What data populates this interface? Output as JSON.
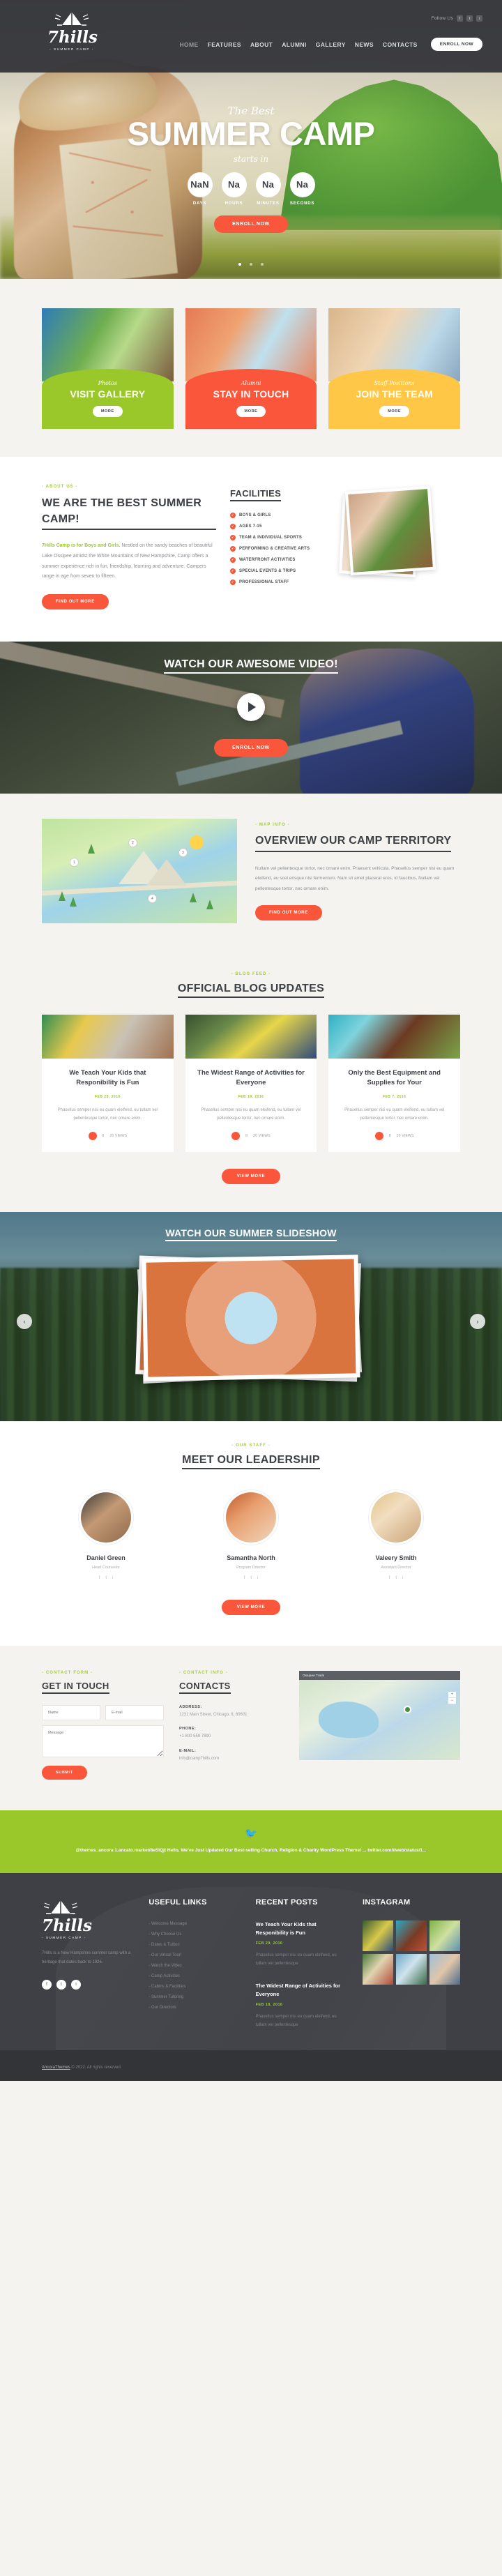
{
  "header": {
    "logo_name": "7hills",
    "logo_sub": "- SUMMER CAMP -",
    "follow_label": "Follow Us",
    "socials": [
      "f",
      "t",
      "i"
    ],
    "nav": [
      {
        "label": "HOME"
      },
      {
        "label": "FEATURES"
      },
      {
        "label": "ABOUT"
      },
      {
        "label": "ALUMNI"
      },
      {
        "label": "GALLERY"
      },
      {
        "label": "NEWS"
      },
      {
        "label": "CONTACTS"
      }
    ],
    "enroll_label": "ENROLL NOW"
  },
  "hero": {
    "pre_title": "The Best",
    "title": "SUMMER CAMP",
    "starts_in": "starts in",
    "countdown": [
      {
        "value": "NaN",
        "label": "DAYS"
      },
      {
        "value": "Na",
        "label": "HOURS"
      },
      {
        "value": "Na",
        "label": "MINUTES"
      },
      {
        "value": "Na",
        "label": "SECONDS"
      }
    ],
    "cta": "ENROLL NOW",
    "slides": 3,
    "active_slide": 1
  },
  "promo": [
    {
      "kicker": "Photos",
      "title": "VISIT GALLERY",
      "more": "MORE"
    },
    {
      "kicker": "Alumni",
      "title": "STAY IN TOUCH",
      "more": "MORE"
    },
    {
      "kicker": "Staff Positions",
      "title": "JOIN THE TEAM",
      "more": "MORE"
    }
  ],
  "about": {
    "label": "- ABOUT US -",
    "title": "WE ARE THE BEST SUMMER CAMP!",
    "lead": "7Hills Camp is for Boys and Girls.",
    "body": " Nestled on the sandy beaches of beautiful Lake Ossipee amidst the White Mountains of New Hampshire, Camp offers a summer experience rich in fun, friendship, learning and adventure. Campers range in age from seven to fifteen.",
    "cta": "FIND OUT MORE",
    "facilities_title": "FACILITIES",
    "facilities": [
      "BOYS & GIRLS",
      "AGES 7-15",
      "TEAM & INDIVIDUAL SPORTS",
      "PERFORMING & CREATIVE ARTS",
      "WATERFRONT ACTIVITIES",
      "SPECIAL EVENTS & TRIPS",
      "PROFESSIONAL STAFF"
    ]
  },
  "video": {
    "title": "WATCH OUR AWESOME VIDEO!",
    "play_icon": "play-icon",
    "cta": "ENROLL NOW"
  },
  "territory": {
    "label": "- MAP INFO -",
    "title": "OVERVIEW OUR CAMP TERRITORY",
    "body": "Nullam vel pellentesque tortor, nec ornare enim. Praesent vehicula. Phasellus semper nisi eu quam eleifend, eu scel erisque nisi fermentum. Nam sit amet placerat eros, id faucibus. Nullam vel pellentesque tortor, nec ornare enim.",
    "cta": "FIND OUT MORE",
    "pins": [
      "1",
      "2",
      "3",
      "4"
    ]
  },
  "blog": {
    "label": "- BLOG FEED -",
    "title": "OFFICIAL BLOG UPDATES",
    "view_more": "VIEW MORE",
    "posts": [
      {
        "title": "We Teach Your Kids that Responibility is Fun",
        "date": "FEB 29, 2016",
        "excerpt": "Phasellus semper nisi eu quam eleifend, eu tullam vel pellentesque tortor, nec ornare enim.",
        "likes": "8",
        "comments": "20 VIEWS"
      },
      {
        "title": "The Widest Range of Activities for Everyone",
        "date": "FEB 18, 2016",
        "excerpt": "Phasellus semper nisi eu quam eleifend, eu tullam vel pellentesque tortor, nec ornare enim.",
        "likes": "8",
        "comments": "20 VIEWS"
      },
      {
        "title": "Only the Best Equipment and Supplies for Your",
        "date": "FEB 7, 2016",
        "excerpt": "Phasellus semper nisi eu quam eleifend, eu tullam vel pellentesque tortor, nec ornare enim.",
        "likes": "8",
        "comments": "20 VIEWS"
      }
    ]
  },
  "slideshow": {
    "title": "WATCH OUR SUMMER SLIDESHOW",
    "prev": "‹",
    "next": "›"
  },
  "leadership": {
    "label": "- OUR STAFF -",
    "title": "MEET OUR LEADERSHIP",
    "view_more": "VIEW MORE",
    "members": [
      {
        "name": "Daniel Green",
        "role": "Head Counselor",
        "socials": [
          "f",
          "t",
          "i"
        ]
      },
      {
        "name": "Samantha North",
        "role": "Program Director",
        "socials": [
          "f",
          "t",
          "i"
        ]
      },
      {
        "name": "Valeery Smith",
        "role": "Assistant Director",
        "socials": [
          "f",
          "t",
          "i"
        ]
      }
    ]
  },
  "contact": {
    "form_label": "- CONTACT FORM -",
    "form_title": "GET IN TOUCH",
    "name_placeholder": "Name",
    "email_placeholder": "E-mail",
    "message_placeholder": "Message",
    "submit": "SUBMIT",
    "info_label": "- CONTACT INFO -",
    "info_title": "CONTACTS",
    "address_label": "ADDRESS:",
    "address_value": "1231 Main Street, Chicago, IL 60601",
    "phone_label": "PHONE:",
    "phone_value": "+1 800 559 7890",
    "email_label": "E-MAIL:",
    "email_value": "info@camp7hills.com",
    "map_title": "Ossipee Trails",
    "map_zoom_in": "+",
    "map_zoom_out": "−"
  },
  "twitter": {
    "icon": "twitter-icon",
    "text": "@themes_ancora 1.ancato.market/8eSIQjt Hello, We've Just Updated Our Best-selling Church, Religion & Charity WordPress Theme! ... twitter.com/i/web/status/1..."
  },
  "footer": {
    "logo_name": "7hills",
    "logo_sub": "- SUMMER CAMP -",
    "about": "7Hills is a New Hampshire summer camp with a heritage that dates back to 1926.",
    "socials": [
      "f",
      "t",
      "i"
    ],
    "links_title": "USEFUL LINKS",
    "links": [
      "- Welcome Message",
      "- Why Choose Us",
      "- Dates & Tuition",
      "- Our Virtual Tour!",
      "- Watch the Video",
      "- Camp Activities",
      "- Cabins & Facilities",
      "- Summer Tutoring",
      "- Our Directors"
    ],
    "recent_title": "RECENT POSTS",
    "recent": [
      {
        "title": "We Teach Your Kids that Responibility is Fun",
        "date": "FEB 29, 2016",
        "excerpt": "Phasellus semper nisi eu quam eleifend, eu tullam vel pellentesque"
      },
      {
        "title": "The Widest Range of Activities for Everyone",
        "date": "FEB 18, 2016",
        "excerpt": "Phasellus semper nisi eu quam eleifend, eu tullam vel pellentesque"
      }
    ],
    "instagram_title": "INSTAGRAM",
    "copyright_brand": "AncoraThemes",
    "copyright_rest": " © 2022. All rights reserved."
  }
}
